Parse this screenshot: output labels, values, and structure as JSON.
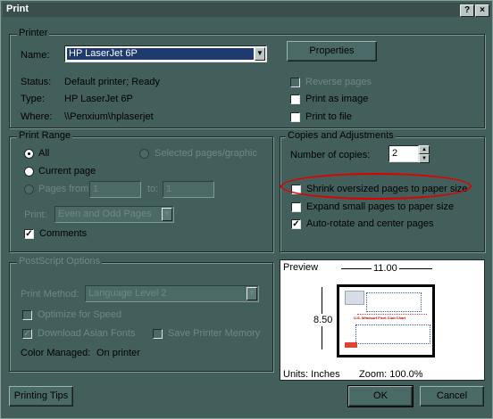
{
  "window": {
    "title": "Print",
    "help_button": "?",
    "close_button": "×"
  },
  "printer": {
    "group_label": "Printer",
    "name_label": "Name:",
    "name_value": "HP LaserJet 6P",
    "properties_button": "Properties",
    "status_label": "Status:",
    "status_value": "Default printer; Ready",
    "type_label": "Type:",
    "type_value": "HP LaserJet 6P",
    "where_label": "Where:",
    "where_value": "\\\\Penxium\\hplaserjet",
    "reverse_pages": {
      "label": "Reverse pages",
      "checked": false,
      "enabled": false
    },
    "print_as_image": {
      "label": "Print as image",
      "checked": false,
      "enabled": true
    },
    "print_to_file": {
      "label": "Print to file",
      "checked": false,
      "enabled": true
    }
  },
  "print_range": {
    "group_label": "Print Range",
    "all_label": "All",
    "current_page_label": "Current page",
    "selected_label": "Selected pages/graphic",
    "pages_from_label": "Pages from",
    "from_value": "1",
    "to_label": "to:",
    "to_value": "1",
    "print_label": "Print:",
    "print_value": "Even and Odd Pages",
    "comments_label": "Comments",
    "comments_checked": true
  },
  "copies": {
    "group_label": "Copies and Adjustments",
    "number_label": "Number of copies:",
    "number_value": "2",
    "shrink": {
      "label": "Shrink oversized pages to paper size",
      "checked": false
    },
    "expand": {
      "label": "Expand small pages to paper size",
      "checked": false
    },
    "autorotate": {
      "label": "Auto-rotate and center pages",
      "checked": true
    },
    "highlight_color": "#e00000"
  },
  "postscript": {
    "group_label": "PostScript Options",
    "method_label": "Print Method:",
    "method_value": "Language Level 2",
    "optimize_label": "Optimize for Speed",
    "download_fonts_label": "Download Asian Fonts",
    "save_memory_label": "Save Printer Memory",
    "color_managed_label": "Color Managed:",
    "color_managed_value": "On printer"
  },
  "preview": {
    "label": "Preview",
    "width_label": "11.00",
    "height_label": "8.50",
    "units": "Units: Inches",
    "zoom": "Zoom: 100.0%",
    "doc_title": "U.S. Windsurf Fleet Club Chart"
  },
  "footer": {
    "tips_button": "Printing Tips",
    "ok_button": "OK",
    "cancel_button": "Cancel"
  }
}
